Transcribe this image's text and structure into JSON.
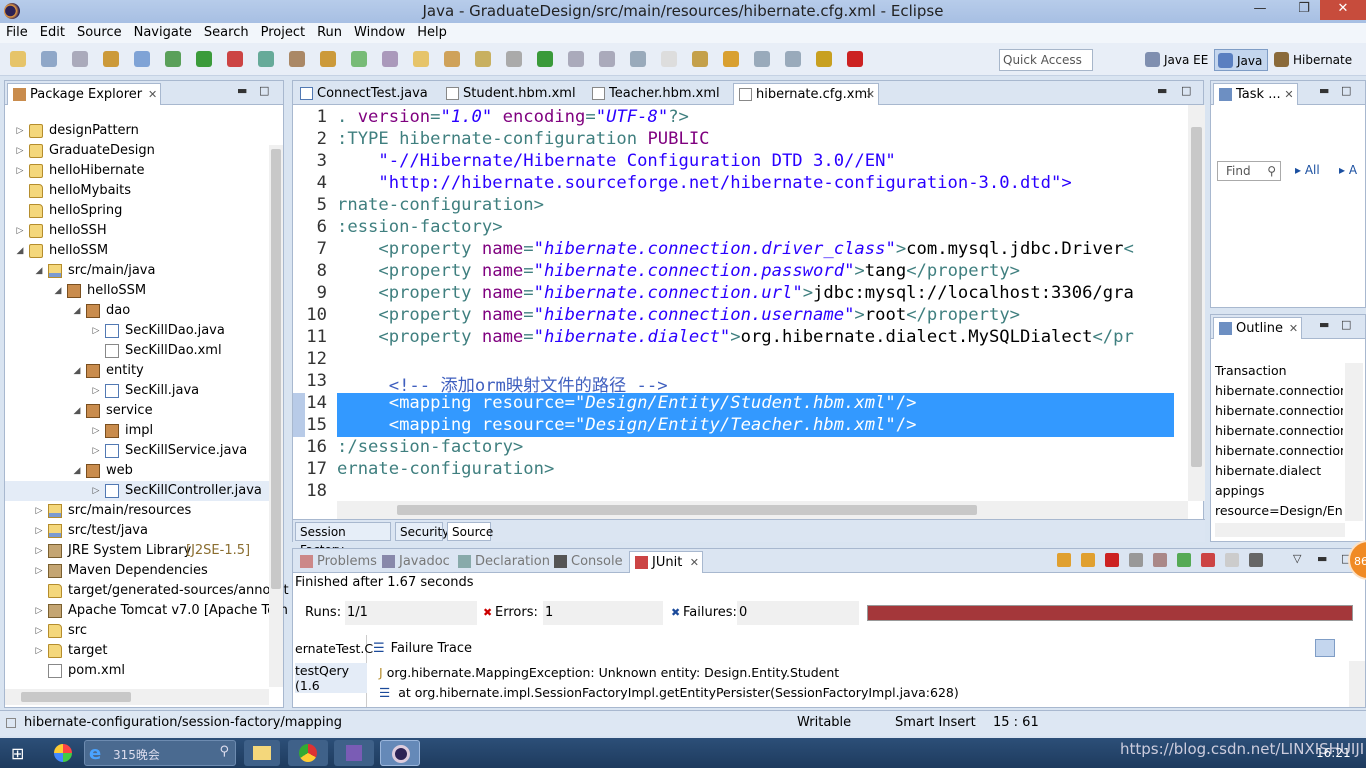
{
  "window": {
    "title": "Java - GraduateDesign/src/main/resources/hibernate.cfg.xml - Eclipse",
    "min": "—",
    "max": "❐",
    "close": "✕"
  },
  "menu": [
    "File",
    "Edit",
    "Source",
    "Navigate",
    "Search",
    "Project",
    "Run",
    "Window",
    "Help"
  ],
  "toolbar": {
    "quick_access_placeholder": "Quick Access",
    "perspectives": [
      "Java EE",
      "Java",
      "Hibernate"
    ]
  },
  "package_explorer": {
    "title": "Package Explorer",
    "items": [
      {
        "label": "designPattern",
        "depth": 0,
        "arrow": "▷",
        "icon": "proj"
      },
      {
        "label": "GraduateDesign",
        "depth": 0,
        "arrow": "▷",
        "icon": "proj"
      },
      {
        "label": "helloHibernate",
        "depth": 0,
        "arrow": "▷",
        "icon": "proj"
      },
      {
        "label": "helloMybaits",
        "depth": 0,
        "arrow": "",
        "icon": "folder"
      },
      {
        "label": "helloSpring",
        "depth": 0,
        "arrow": "",
        "icon": "folder"
      },
      {
        "label": "helloSSH",
        "depth": 0,
        "arrow": "▷",
        "icon": "proj"
      },
      {
        "label": "helloSSM",
        "depth": 0,
        "arrow": "◢",
        "icon": "proj"
      },
      {
        "label": "src/main/java",
        "depth": 1,
        "arrow": "◢",
        "icon": "src"
      },
      {
        "label": "helloSSM",
        "depth": 2,
        "arrow": "◢",
        "icon": "pkg"
      },
      {
        "label": "dao",
        "depth": 3,
        "arrow": "◢",
        "icon": "pkg"
      },
      {
        "label": "SecKillDao.java",
        "depth": 4,
        "arrow": "▷",
        "icon": "java"
      },
      {
        "label": "SecKillDao.xml",
        "depth": 4,
        "arrow": "",
        "icon": "xml"
      },
      {
        "label": "entity",
        "depth": 3,
        "arrow": "◢",
        "icon": "pkg"
      },
      {
        "label": "SecKill.java",
        "depth": 4,
        "arrow": "▷",
        "icon": "java"
      },
      {
        "label": "service",
        "depth": 3,
        "arrow": "◢",
        "icon": "pkg"
      },
      {
        "label": "impl",
        "depth": 4,
        "arrow": "▷",
        "icon": "pkg"
      },
      {
        "label": "SecKillService.java",
        "depth": 4,
        "arrow": "▷",
        "icon": "java"
      },
      {
        "label": "web",
        "depth": 3,
        "arrow": "◢",
        "icon": "pkg"
      },
      {
        "label": "SecKillController.java",
        "depth": 4,
        "arrow": "▷",
        "icon": "java"
      },
      {
        "label": "src/main/resources",
        "depth": 1,
        "arrow": "▷",
        "icon": "src"
      },
      {
        "label": "src/test/java",
        "depth": 1,
        "arrow": "▷",
        "icon": "src"
      },
      {
        "label": "JRE System Library",
        "extra": "[J2SE-1.5]",
        "depth": 1,
        "arrow": "▷",
        "icon": "lib"
      },
      {
        "label": "Maven Dependencies",
        "depth": 1,
        "arrow": "▷",
        "icon": "lib"
      },
      {
        "label": "target/generated-sources/annotat",
        "depth": 1,
        "arrow": "",
        "icon": "folder"
      },
      {
        "label": "Apache Tomcat v7.0 [Apache Tom",
        "depth": 1,
        "arrow": "▷",
        "icon": "lib"
      },
      {
        "label": "src",
        "depth": 1,
        "arrow": "▷",
        "icon": "folder"
      },
      {
        "label": "target",
        "depth": 1,
        "arrow": "▷",
        "icon": "folder"
      },
      {
        "label": "pom.xml",
        "depth": 1,
        "arrow": "",
        "icon": "xml"
      }
    ]
  },
  "editor": {
    "tabs": [
      "ConnectTest.java",
      "Student.hbm.xml",
      "Teacher.hbm.xml",
      "hibernate.cfg.xml"
    ],
    "active_tab": "hibernate.cfg.xml",
    "bottom_tabs": [
      "Session Factory",
      "Security",
      "Source"
    ],
    "lines": [
      {
        "n": "1",
        "segs": [
          [
            ". ",
            "t"
          ],
          [
            "version",
            "k"
          ],
          [
            "=",
            "t"
          ],
          [
            "\"1.0\"",
            "s"
          ],
          [
            " encoding",
            "k"
          ],
          [
            "=",
            "t"
          ],
          [
            "\"UTF-8\"",
            "s"
          ],
          [
            "?>",
            "t"
          ]
        ]
      },
      {
        "n": "2",
        "segs": [
          [
            ":TYPE hibernate-configuration ",
            "t"
          ],
          [
            "PUBLIC",
            "k"
          ]
        ]
      },
      {
        "n": "3",
        "segs": [
          [
            "    \"-//Hibernate/Hibernate Configuration DTD 3.0//EN\"",
            "s2"
          ]
        ]
      },
      {
        "n": "4",
        "segs": [
          [
            "    \"http://hibernate.sourceforge.net/hibernate-configuration-3.0.dtd\">",
            "s2"
          ]
        ]
      },
      {
        "n": "5",
        "segs": [
          [
            "rnate-configuration>",
            "t"
          ]
        ]
      },
      {
        "n": "6",
        "segs": [
          [
            ":ession-factory>",
            "t"
          ]
        ]
      },
      {
        "n": "7",
        "segs": [
          [
            "    <property ",
            "t"
          ],
          [
            "name",
            "k"
          ],
          [
            "=",
            "t"
          ],
          [
            "\"hibernate.connection.driver_class\"",
            "s"
          ],
          [
            ">",
            "t"
          ],
          [
            "com.mysql.jdbc.Driver",
            "x"
          ],
          [
            "<",
            "t"
          ]
        ]
      },
      {
        "n": "8",
        "segs": [
          [
            "    <property ",
            "t"
          ],
          [
            "name",
            "k"
          ],
          [
            "=",
            "t"
          ],
          [
            "\"hibernate.connection.password\"",
            "s"
          ],
          [
            ">",
            "t"
          ],
          [
            "tang",
            "x"
          ],
          [
            "</property>",
            "t"
          ]
        ]
      },
      {
        "n": "9",
        "segs": [
          [
            "    <property ",
            "t"
          ],
          [
            "name",
            "k"
          ],
          [
            "=",
            "t"
          ],
          [
            "\"hibernate.connection.url\"",
            "s"
          ],
          [
            ">",
            "t"
          ],
          [
            "jdbc:mysql://localhost:3306/gra",
            "x"
          ]
        ]
      },
      {
        "n": "10",
        "segs": [
          [
            "    <property ",
            "t"
          ],
          [
            "name",
            "k"
          ],
          [
            "=",
            "t"
          ],
          [
            "\"hibernate.connection.username\"",
            "s"
          ],
          [
            ">",
            "t"
          ],
          [
            "root",
            "x"
          ],
          [
            "</property>",
            "t"
          ]
        ]
      },
      {
        "n": "11",
        "segs": [
          [
            "    <property ",
            "t"
          ],
          [
            "name",
            "k"
          ],
          [
            "=",
            "t"
          ],
          [
            "\"hibernate.dialect\"",
            "s"
          ],
          [
            ">",
            "t"
          ],
          [
            "org.hibernate.dialect.MySQLDialect",
            "x"
          ],
          [
            "</pr",
            "t"
          ]
        ]
      },
      {
        "n": "12",
        "segs": []
      },
      {
        "n": "13",
        "segs": [
          [
            "     <!-- 添加orm映射文件的路径 -->",
            "c"
          ]
        ]
      },
      {
        "n": "14",
        "sel": true,
        "segs": [
          [
            "     <mapping resource=",
            "w"
          ],
          [
            "\"Design/Entity/Student.hbm.xml\"",
            "wi"
          ],
          [
            "/>",
            "w"
          ]
        ]
      },
      {
        "n": "15",
        "sel": true,
        "segs": [
          [
            "     <mapping resource=",
            "w"
          ],
          [
            "\"Design/Entity/Teacher.hbm.xml\"",
            "wi"
          ],
          [
            "/>",
            "w"
          ]
        ]
      },
      {
        "n": "16",
        "segs": [
          [
            ":/session-factory>",
            "t"
          ]
        ]
      },
      {
        "n": "17",
        "segs": [
          [
            "ernate-configuration>",
            "t"
          ]
        ]
      },
      {
        "n": "18",
        "segs": []
      }
    ]
  },
  "task_list": {
    "title": "Task ...",
    "find_placeholder": "Find",
    "all": "All",
    "a": "A"
  },
  "outline": {
    "title": "Outline",
    "items": [
      "Transaction",
      "hibernate.connection.c",
      "hibernate.connection.p",
      "hibernate.connection.u",
      "hibernate.connection.u",
      "hibernate.dialect",
      "appings",
      "resource=Design/Entit"
    ]
  },
  "bottom": {
    "tabs": [
      "Problems",
      "Javadoc",
      "Declaration",
      "Console",
      "JUnit"
    ],
    "active_tab": "JUnit",
    "finished": "Finished after 1.67 seconds",
    "runs_label": "Runs:",
    "runs": "1/1",
    "errors_label": "Errors:",
    "errors": "1",
    "failures_label": "Failures:",
    "failures": "0",
    "tests": [
      "ernateTest.C",
      "testQery (1.6"
    ],
    "failure_trace_label": "Failure Trace",
    "trace": [
      "org.hibernate.MappingException: Unknown entity: Design.Entity.Student",
      "at org.hibernate.impl.SessionFactoryImpl.getEntityPersister(SessionFactoryImpl.java:628)"
    ],
    "progress_color": "#a4373a"
  },
  "status": {
    "path": "hibernate-configuration/session-factory/mapping",
    "writable": "Writable",
    "insert": "Smart Insert",
    "pos": "15 : 61"
  },
  "taskbar": {
    "search_text": "315晚会",
    "clock": "16:21",
    "watermark": "https://blog.csdn.net/LINXISHUIJI",
    "badge": "86"
  }
}
